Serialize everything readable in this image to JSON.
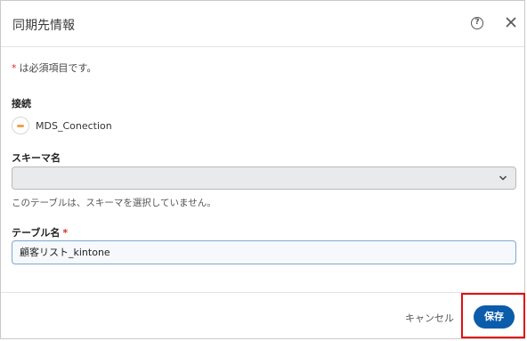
{
  "dialog": {
    "title": "同期先情報",
    "help_icon": "?"
  },
  "form": {
    "required_asterisk": "*",
    "required_note": "は必須項目です。",
    "connection": {
      "label": "接続",
      "name": "MDS_Conection"
    },
    "schema": {
      "label": "スキーマ名",
      "value": "",
      "hint": "このテーブルは、スキーマを選択していません。"
    },
    "table": {
      "label": "テーブル名",
      "required_asterisk": "*",
      "value": "顧客リスト_kintone"
    }
  },
  "footer": {
    "cancel_label": "キャンセル",
    "save_label": "保存"
  },
  "colors": {
    "primary": "#0b5cab",
    "required": "#d93025",
    "highlight": "#e01010"
  }
}
